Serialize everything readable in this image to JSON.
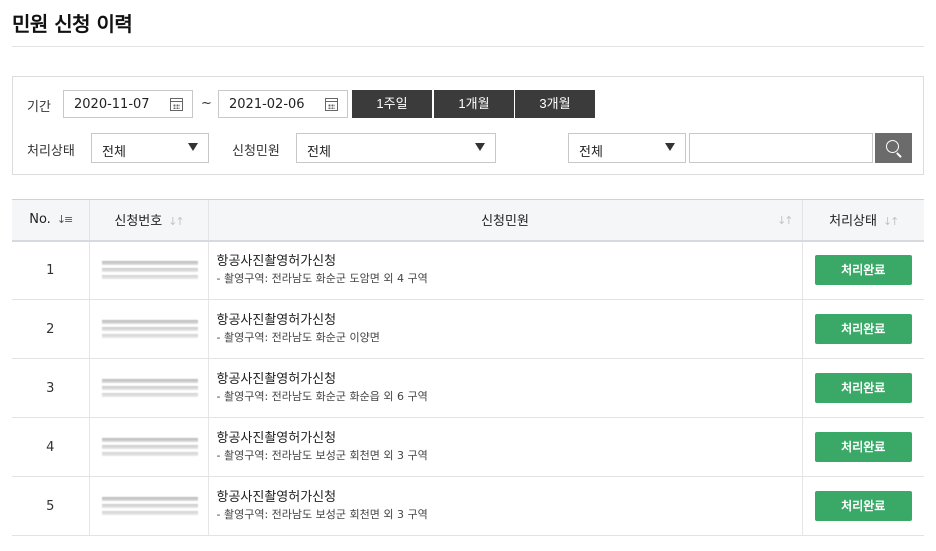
{
  "page": {
    "title": "민원 신청 이력"
  },
  "search": {
    "period_label": "기간",
    "start_date": "2020-11-07",
    "tilde": "~",
    "end_date": "2021-02-06",
    "period_buttons": [
      "1주일",
      "1개월",
      "3개월"
    ],
    "status_label": "처리상태",
    "status_value": "전체",
    "civil_label": "신청민원",
    "civil_value": "전체",
    "field_value": "전체",
    "keyword": ""
  },
  "table": {
    "headers": {
      "no": "No.",
      "app_no": "신청번호",
      "civil": "신청민원",
      "status": "처리상태"
    },
    "rows": [
      {
        "no": "1",
        "title": "항공사진촬영허가신청",
        "sub": "- 촬영구역: 전라남도 화순군 도암면 외 4 구역",
        "status": "처리완료"
      },
      {
        "no": "2",
        "title": "항공사진촬영허가신청",
        "sub": "- 촬영구역: 전라남도 화순군 이양면",
        "status": "처리완료"
      },
      {
        "no": "3",
        "title": "항공사진촬영허가신청",
        "sub": "- 촬영구역: 전라남도 화순군 화순읍 외 6 구역",
        "status": "처리완료"
      },
      {
        "no": "4",
        "title": "항공사진촬영허가신청",
        "sub": "- 촬영구역: 전라남도 보성군 회천면 외 3 구역",
        "status": "처리완료"
      },
      {
        "no": "5",
        "title": "항공사진촬영허가신청",
        "sub": "- 촬영구역: 전라남도 보성군 회천면 외 3 구역",
        "status": "처리완료"
      }
    ]
  },
  "colors": {
    "status_done": "#3aa867",
    "period_button": "#3b3b3b",
    "search_button": "#6b6b6b"
  }
}
